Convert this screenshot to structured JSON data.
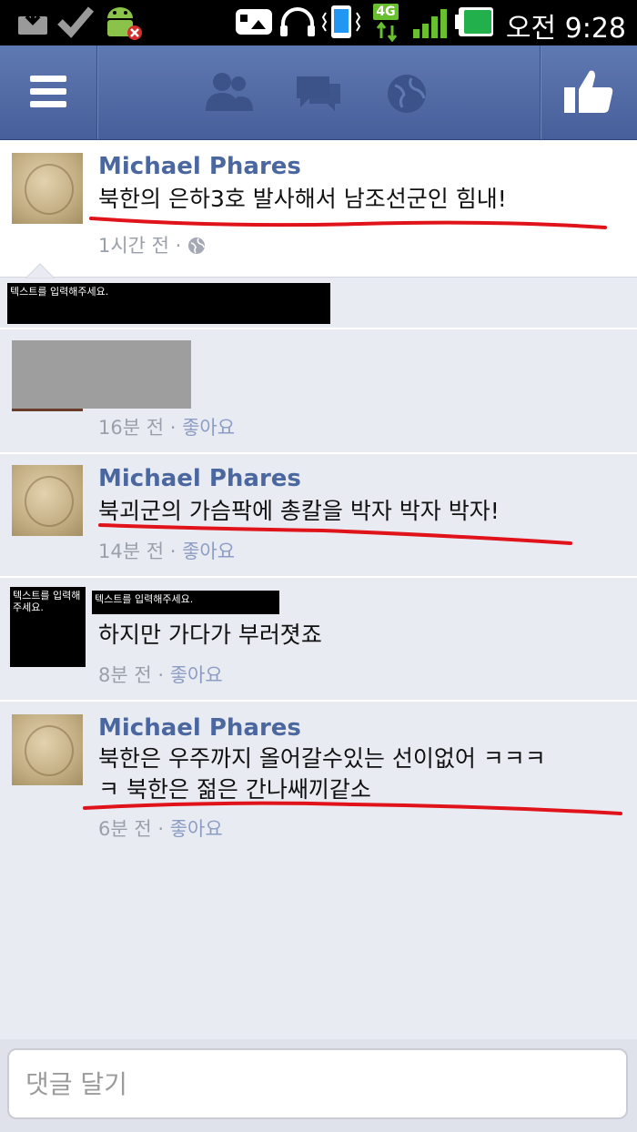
{
  "status_bar": {
    "time": "오전 9:28",
    "network": "4G",
    "icons": [
      "download-icon",
      "check-icon",
      "android-debug-icon",
      "gallery-icon",
      "headphones-icon",
      "vibrate-icon",
      "network-4g-icon",
      "signal-icon",
      "battery-icon"
    ]
  },
  "header": {
    "menu_icon": "hamburger-menu-icon",
    "nav_icons": [
      "friend-requests-icon",
      "messages-icon",
      "notifications-globe-icon"
    ],
    "like_icon": "thumbs-up-icon"
  },
  "post": {
    "author": "Michael Phares",
    "text": "북한의 은하3호 발사해서 남조선군인 힘내!",
    "time": "1시간 전 ·",
    "privacy_icon": "globe-icon"
  },
  "comments": [
    {
      "redacted_label": "텍스트를 입력해주세요.",
      "time": "",
      "like": ""
    },
    {
      "time": "16분 전 ·",
      "like": "좋아요"
    },
    {
      "author": "Michael Phares",
      "text": "북괴군의 가슴팍에 총칼을 박자 박자 박자!",
      "time": "14분 전 ·",
      "like": "좋아요"
    },
    {
      "avatar_label": "텍스트를 입력해주세요.",
      "name_label": "텍스트를 입력해주세요.",
      "text": "하지만 가다가 부러졋죠",
      "time": "8분 전 ·",
      "like": "좋아요"
    },
    {
      "author": "Michael Phares",
      "text_line1": "북한은 우주까지 올어갈수있는 선이없어 ㅋㅋㅋ",
      "text_line2": "ㅋ 북한은 젊은 간나쌔끼같소",
      "time": "6분 전 ·",
      "like": "좋아요"
    }
  ],
  "comment_box": {
    "placeholder": "댓글 달기"
  },
  "colors": {
    "fb_blue": "#4b67a0",
    "header_bg": "#5470ab",
    "annotation_red": "#e0131b"
  }
}
